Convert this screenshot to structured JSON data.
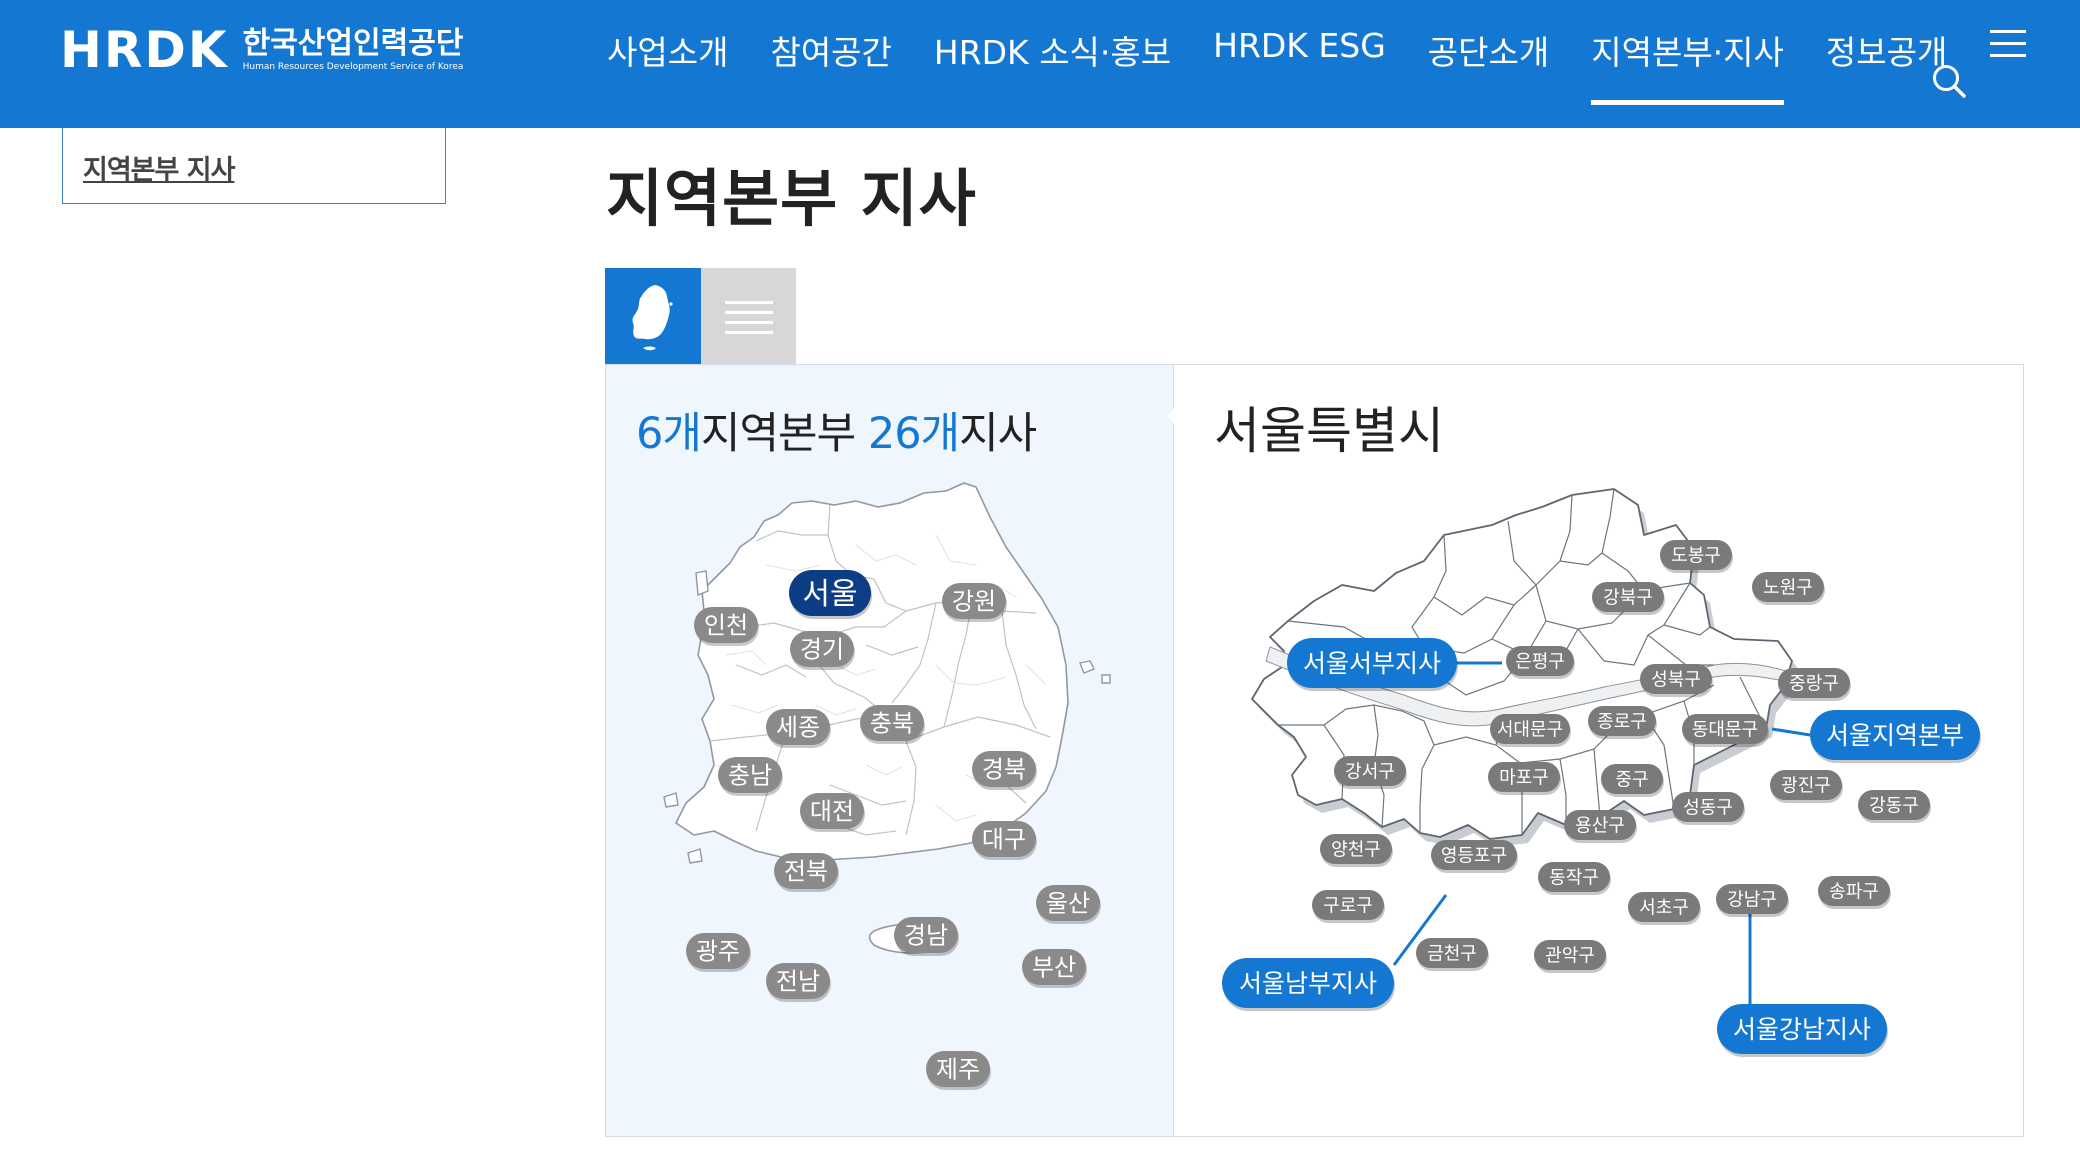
{
  "header": {
    "logo_mark": "HRDK",
    "logo_korean": "한국산업인력공단",
    "logo_english": "Human Resources Development Service of Korea",
    "nav": [
      {
        "label": "사업소개",
        "active": false
      },
      {
        "label": "참여공간",
        "active": false
      },
      {
        "label": "HRDK 소식·홍보",
        "active": false
      },
      {
        "label": "HRDK ESG",
        "active": false
      },
      {
        "label": "공단소개",
        "active": false
      },
      {
        "label": "지역본부·지사",
        "active": true
      },
      {
        "label": "정보공개",
        "active": false
      }
    ],
    "icons": {
      "search": "search-icon",
      "menu": "menu-icon"
    }
  },
  "sidebar": {
    "link": "지역본부 지사"
  },
  "page": {
    "title": "지역본부 지사"
  },
  "view_tabs": [
    {
      "icon": "korea-map-icon",
      "active": true
    },
    {
      "icon": "list-icon",
      "active": false
    }
  ],
  "summary": {
    "regions_num": "6개",
    "regions_label": "지역본부",
    "branches_num": "26개",
    "branches_label": "지사"
  },
  "korea_map": {
    "regions": [
      "서울",
      "강원",
      "인천",
      "경기",
      "세종",
      "충북",
      "충남",
      "경북",
      "대전",
      "대구",
      "전북",
      "울산",
      "경남",
      "광주",
      "부산",
      "전남",
      "제주"
    ],
    "selected": "서울"
  },
  "seoul": {
    "title": "서울특별시",
    "districts": [
      "도봉구",
      "노원구",
      "강북구",
      "은평구",
      "성북구",
      "중랑구",
      "종로구",
      "서대문구",
      "동대문구",
      "강서구",
      "마포구",
      "중구",
      "광진구",
      "성동구",
      "강동구",
      "용산구",
      "양천구",
      "영등포구",
      "동작구",
      "송파구",
      "구로구",
      "강남구",
      "서초구",
      "금천구",
      "관악구"
    ],
    "offices": [
      "서울서부지사",
      "서울지역본부",
      "서울남부지사",
      "서울강남지사"
    ]
  },
  "colors": {
    "primary": "#1478d2",
    "selected_region": "#0d3e85",
    "region_pill": "#8a8a8a",
    "district_pill": "#7a7a7a",
    "panel_bg": "#eff6fd",
    "tab_inactive": "#d7d7d7"
  }
}
